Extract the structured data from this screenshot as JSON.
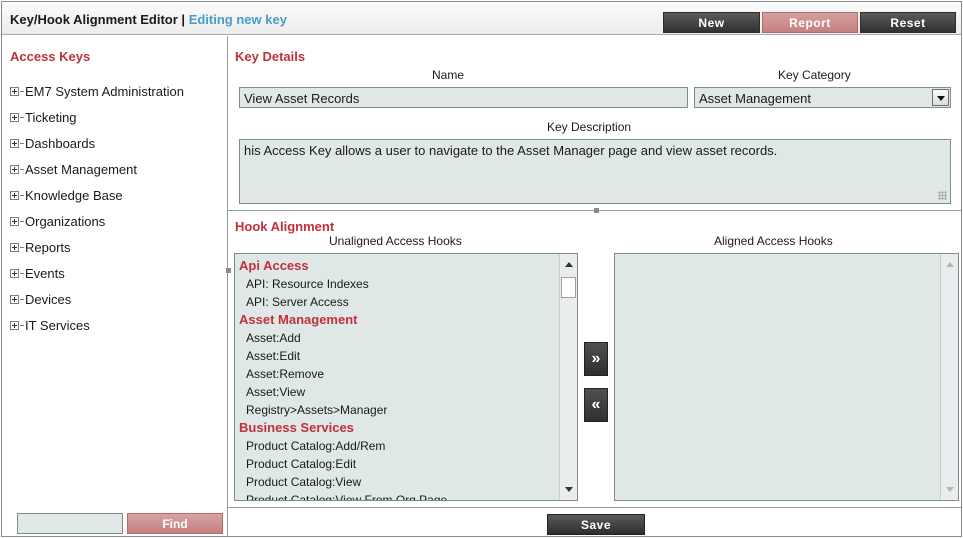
{
  "header": {
    "title": "Key/Hook Alignment Editor",
    "separator": " | ",
    "subtitle": "Editing new key",
    "buttons": {
      "new": "New",
      "report": "Report",
      "reset": "Reset"
    }
  },
  "sidebar": {
    "heading": "Access Keys",
    "items": [
      {
        "label": "EM7 System Administration"
      },
      {
        "label": "Ticketing"
      },
      {
        "label": "Dashboards"
      },
      {
        "label": "Asset Management"
      },
      {
        "label": "Knowledge Base"
      },
      {
        "label": "Organizations"
      },
      {
        "label": "Reports"
      },
      {
        "label": "Events"
      },
      {
        "label": "Devices"
      },
      {
        "label": "IT Services"
      }
    ],
    "find_value": "",
    "find_label": "Find"
  },
  "key_details": {
    "heading": "Key Details",
    "name_label": "Name",
    "name_value": "View Asset Records",
    "category_label": "Key Category",
    "category_value": "Asset Management",
    "description_label": "Key Description",
    "description_value": "his Access Key allows a user to navigate to the Asset Manager page and view asset records."
  },
  "hook_alignment": {
    "heading": "Hook Alignment",
    "unaligned_label": "Unaligned Access Hooks",
    "aligned_label": "Aligned Access Hooks",
    "move_right": "»",
    "move_left": "«",
    "unaligned": [
      {
        "type": "group",
        "label": "Api Access"
      },
      {
        "type": "item",
        "label": "API: Resource Indexes"
      },
      {
        "type": "item",
        "label": "API: Server Access"
      },
      {
        "type": "group",
        "label": "Asset Management"
      },
      {
        "type": "item",
        "label": "Asset:Add"
      },
      {
        "type": "item",
        "label": "Asset:Edit"
      },
      {
        "type": "item",
        "label": "Asset:Remove"
      },
      {
        "type": "item",
        "label": "Asset:View"
      },
      {
        "type": "item",
        "label": "Registry>Assets>Manager"
      },
      {
        "type": "group",
        "label": "Business Services"
      },
      {
        "type": "item",
        "label": "Product Catalog:Add/Rem"
      },
      {
        "type": "item",
        "label": "Product Catalog:Edit"
      },
      {
        "type": "item",
        "label": "Product Catalog:View"
      },
      {
        "type": "item",
        "label": "Product Catalog:View From Org Page"
      }
    ],
    "aligned": []
  },
  "footer": {
    "save_label": "Save"
  },
  "colors": {
    "accent_red": "#c0313c",
    "subtitle_blue": "#4a9cc8",
    "field_bg": "#dfe7e7",
    "pink_button": "#c47f80"
  }
}
